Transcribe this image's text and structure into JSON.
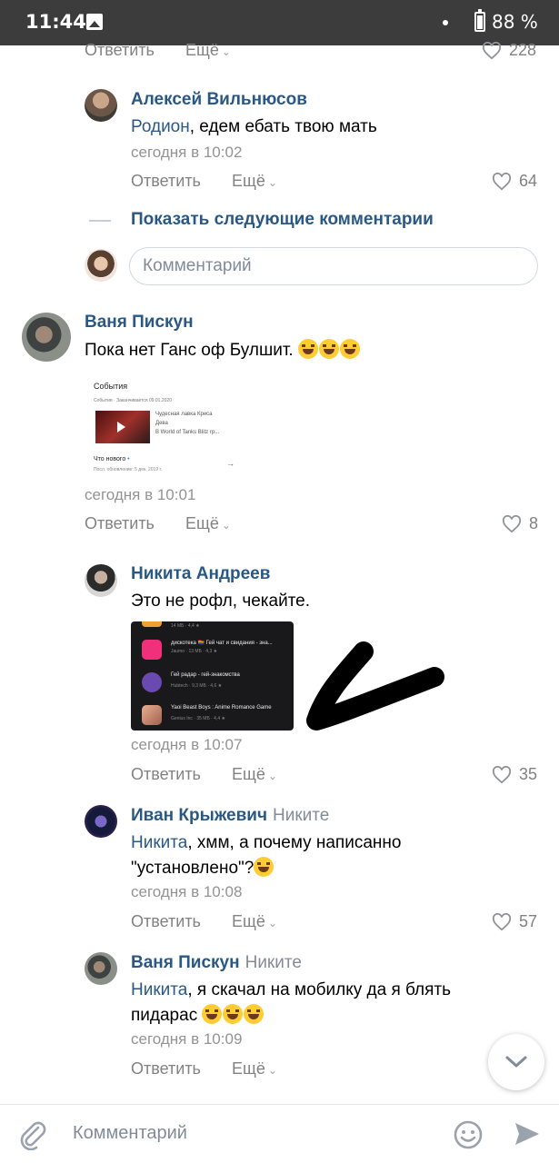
{
  "status_bar": {
    "time": "11:44",
    "battery": "88 %"
  },
  "top_partial": {
    "reply": "Ответить",
    "more": "Ещё",
    "likes": "228"
  },
  "comments": [
    {
      "name": "Алексей Вильнюсов",
      "mention": "Родион",
      "text": ", едем ебать твою мать",
      "time": "сегодня в 10:02",
      "reply": "Ответить",
      "more": "Ещё",
      "likes": "64"
    },
    {
      "name": "Ваня Пискун",
      "text": "Пока нет Ганс оф Булшит.",
      "time": "сегодня в 10:01",
      "reply": "Ответить",
      "more": "Ещё",
      "likes": "8"
    },
    {
      "name": "Никита Андреев",
      "text": "Это не рофл, чекайте.",
      "time": "сегодня в 10:07",
      "reply": "Ответить",
      "more": "Ещё",
      "likes": "35"
    },
    {
      "name": "Иван Крыжевич",
      "reply_to": "Никите",
      "mention": "Никита",
      "text_line1": ", хмм, а почему написанно",
      "text_line2": "\"установлено\"?",
      "time": "сегодня в 10:08",
      "reply": "Ответить",
      "more": "Ещё",
      "likes": "57"
    },
    {
      "name": "Ваня Пискун",
      "reply_to": "Никите",
      "mention": "Никита",
      "text_line1": ", я скачал на мобилку да я блять",
      "text_line2": "пидарас",
      "time": "сегодня в 10:09",
      "reply": "Ответить",
      "more": "Ещё"
    }
  ],
  "show_more": "Показать следующие комментарии",
  "reply_input_placeholder": "Комментарий",
  "bottom_input_placeholder": "Комментарий",
  "attachment1": {
    "title": "События",
    "meta": "События · Заканчивается 09.01.2020",
    "item1": "Чудесная лавка Криса",
    "item2": "Дева",
    "item3": "В World of Tanks Blitz гр...",
    "section": "Что нового",
    "section_meta": "Посл. обновление: 5 дек. 2019 г."
  },
  "attachment2": {
    "rows": [
      {
        "title": "",
        "sub": "14 МБ · 4,4 ★"
      },
      {
        "title": "дискотека 🏳️‍🌈 Гей чат и свидания - зна...",
        "sub": "Jaumo · 13 МБ · 4,3 ★"
      },
      {
        "title": "Гей радар - гей-знакомства",
        "sub": "Hubtech · 9,3 МБ · 4,6 ★"
      },
      {
        "title": "Yaoi Beast Boys : Anime Romance Game",
        "sub": "Genius Inc · 35 МБ · 4,4 ★"
      }
    ]
  },
  "colors": {
    "link": "#2a5885",
    "meta": "#939393",
    "action": "#828282",
    "status_bar": "#3c3c3c"
  }
}
